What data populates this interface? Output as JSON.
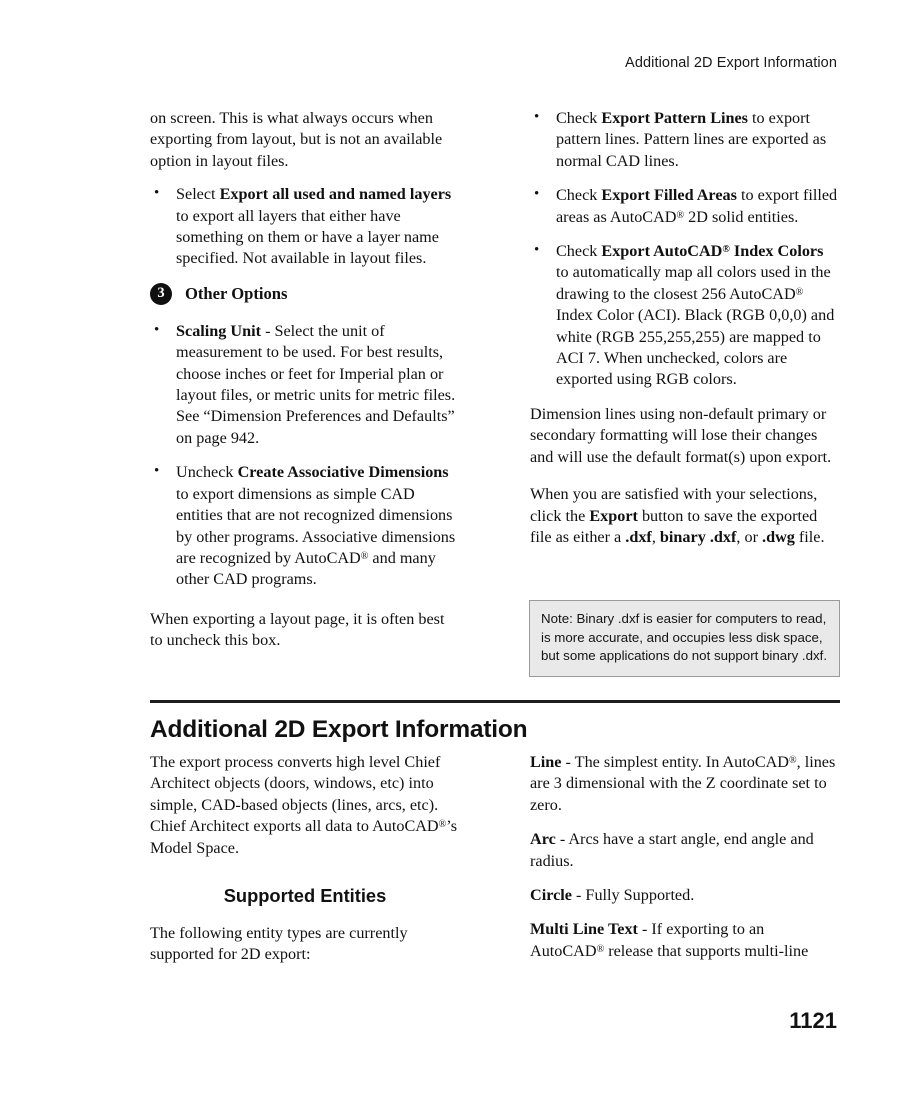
{
  "header": {
    "running_title": "Additional 2D Export Information"
  },
  "upper_left_column": {
    "continuation_paragraph": "on screen. This is what always occurs when exporting from layout, but is not an available option in layout files.",
    "bullets": [
      {
        "lead_plain": "Select ",
        "lead_bold": "Export all used and named layers",
        "rest": " to export all layers that either have something on them or have a layer name specified. Not available in layout files."
      }
    ],
    "callout": {
      "number": "3",
      "title": "Other Options"
    },
    "option_bullets": [
      {
        "bold": "Scaling Unit",
        "rest": " - Select the unit of measurement to be used. For best results, choose inches or feet for Imperial plan or layout files, or metric units for metric files. See “Dimension Preferences and Defaults” on page 942."
      },
      {
        "lead_plain": "Uncheck ",
        "bold": "Create Associative Dimensions",
        "rest_a": " to export dimensions as simple CAD entities that are not recognized dimensions by other programs. Associative dimensions are recognized by AutoCAD",
        "rest_b": " and many other CAD programs."
      }
    ],
    "layout_note": "When exporting a layout page, it is often best to uncheck this box."
  },
  "upper_right_column": {
    "bullets": [
      {
        "lead_plain": "Check ",
        "bold": "Export Pattern Lines",
        "rest": " to export pattern lines. Pattern lines are exported as normal CAD lines."
      },
      {
        "lead_plain": "Check ",
        "bold": "Export Filled Areas",
        "rest_a": " to export filled areas as AutoCAD",
        "rest_b": " 2D solid entities."
      },
      {
        "lead_plain": "Check ",
        "bold_a": "Export AutoCAD",
        "bold_b": " Index Colors",
        "rest_a": " to automatically map all colors used in the drawing to the closest 256 AutoCAD",
        "rest_b": " Index Color (ACI). Black (RGB 0,0,0) and white (RGB 255,255,255) are mapped to ACI 7. When unchecked, colors are exported using RGB colors."
      }
    ],
    "dimension_paragraph": "Dimension lines using non-default primary or secondary formatting will lose their changes and will use the default format(s) upon export.",
    "export_paragraph": {
      "part_1": "When you are satisfied with your selections, click the ",
      "bold_1": "Export",
      "part_2": " button to save the exported file as either a ",
      "bold_2": ".dxf",
      "part_3": ", ",
      "bold_3": "binary .dxf",
      "part_4": ", or ",
      "bold_4": ".dwg",
      "part_5": " file."
    }
  },
  "note_box": {
    "text": "Note: Binary .dxf is easier for computers to read, is more accurate, and occupies less disk space, but some applications do not support binary .dxf."
  },
  "section": {
    "title": "Additional 2D Export Information",
    "intro_paragraph_a": "The export process converts high level Chief Architect objects (doors, windows, etc) into simple, CAD-based objects (lines, arcs, etc). Chief Architect exports all data to AutoCAD",
    "intro_paragraph_b": "’s Model Space.",
    "sub_heading": "Supported Entities",
    "supported_intro": "The following entity types are currently supported for 2D export:",
    "entities": [
      {
        "name": "Line",
        "desc_a": " - The simplest entity. In AutoCAD",
        "desc_b": ", lines are 3 dimensional with the Z coordinate set to zero."
      },
      {
        "name": "Arc",
        "desc_a": " - Arcs have a start angle, end angle and radius.",
        "desc_b": ""
      },
      {
        "name": "Circle",
        "desc_a": " - Fully Supported.",
        "desc_b": ""
      },
      {
        "name": "Multi Line Text",
        "desc_a": " - If exporting to an AutoCAD",
        "desc_b": " release that supports multi-line"
      }
    ]
  },
  "footer": {
    "page_number": "1121"
  },
  "symbols": {
    "registered": "®",
    "bullet": "•"
  }
}
